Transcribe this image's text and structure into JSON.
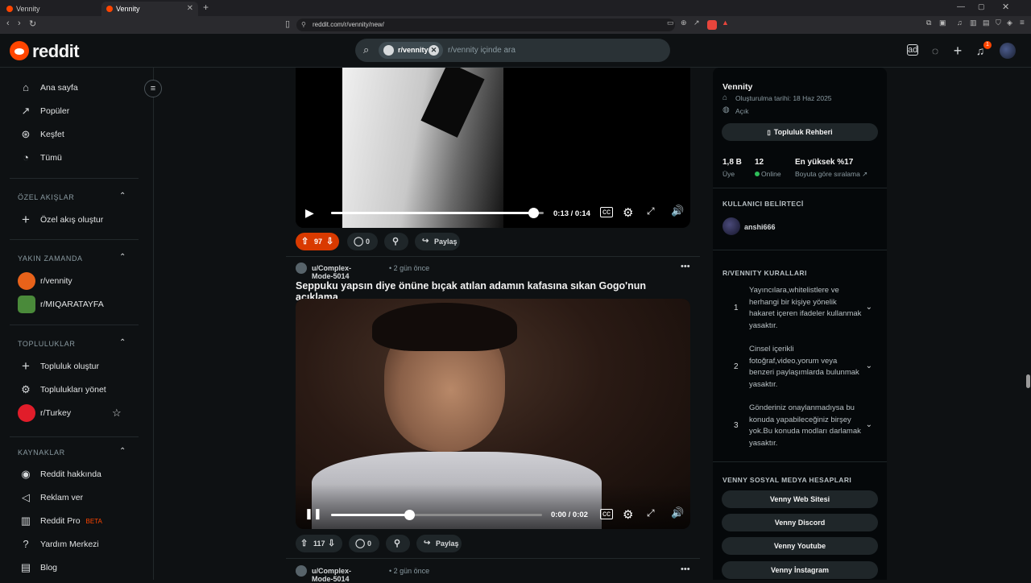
{
  "browser": {
    "tabs": [
      {
        "title": "Vennity",
        "active": false
      },
      {
        "title": "Vennity",
        "active": true
      }
    ],
    "new_tab_label": "+",
    "url": "reddit.com/r/vennity/new/"
  },
  "header": {
    "logo_text": "reddit",
    "search_chip": "r/vennity",
    "search_placeholder": "r/vennity içinde ara",
    "notification_count": "1"
  },
  "sidebar": {
    "main_items": [
      {
        "label": "Ana sayfa",
        "icon": "home-icon"
      },
      {
        "label": "Popüler",
        "icon": "popular-icon"
      },
      {
        "label": "Keşfet",
        "icon": "explore-icon"
      },
      {
        "label": "Tümü",
        "icon": "all-icon"
      }
    ],
    "custom_feeds": {
      "title": "ÖZEL AKIŞLAR",
      "create_label": "Özel akış oluştur"
    },
    "recent": {
      "title": "YAKIN ZAMANDA",
      "items": [
        "r/vennity",
        "r/MIQARATAYFA"
      ]
    },
    "communities": {
      "title": "TOPLULUKLAR",
      "items": [
        "Topluluk oluştur",
        "Toplulukları yönet",
        "r/Turkey"
      ]
    },
    "resources": {
      "title": "KAYNAKLAR",
      "items": [
        "Reddit hakkında",
        "Reklam ver",
        "Reddit Pro",
        "Yardım Merkezi",
        "Blog"
      ],
      "beta_label": "BETA"
    }
  },
  "feed": {
    "post1": {
      "video_time": "0:13 / 0:14",
      "progress": 0.95,
      "votes": "97",
      "comments": "0",
      "share_label": "Paylaş"
    },
    "post2": {
      "author": "u/Complex-Mode-5014",
      "time": "• 2 gün önce",
      "title": "Seppuku yapsın diye önüne bıçak atılan adamın kafasına sıkan Gogo'nun açıklama",
      "video_time": "0:00 / 0:02",
      "progress": 0.37,
      "votes": "117",
      "comments": "0",
      "share_label": "Paylaş"
    },
    "post3": {
      "author": "u/Complex-Mode-5014",
      "time": "• 2 gün önce"
    }
  },
  "community": {
    "name": "Vennity",
    "created": "Oluşturulma tarihi: 18 Haz 2025",
    "visibility": "Açık",
    "guide_button": "Topluluk Rehberi",
    "stats": {
      "members_value": "1,8 B",
      "members_label": "Üye",
      "online_value": "12",
      "online_label": "Online",
      "rank_value": "En yüksek %17",
      "rank_label": "Boyuta göre sıralama"
    },
    "flair_title": "KULLANICI BELİRTECİ",
    "flair_user": "anshi666",
    "rules_title": "R/VENNITY KURALLARI",
    "rules": [
      {
        "num": "1",
        "text": "Yayıncılara,whitelistlere ve herhangi bir kişiye yönelik hakaret içeren ifadeler kullanmak yasaktır."
      },
      {
        "num": "2",
        "text": "Cinsel içerikli fotoğraf,video,yorum veya benzeri paylaşımlarda bulunmak yasaktır."
      },
      {
        "num": "3",
        "text": "Gönderiniz onaylanmadıysa bu konuda yapabileceğiniz birşey yok.Bu konuda modları darlamak yasaktır."
      }
    ],
    "social_title": "VENNY SOSYAL MEDYA HESAPLARI",
    "social_links": [
      "Venny Web Sitesi",
      "Venny Discord",
      "Venny Youtube",
      "Venny İnstagram"
    ]
  }
}
